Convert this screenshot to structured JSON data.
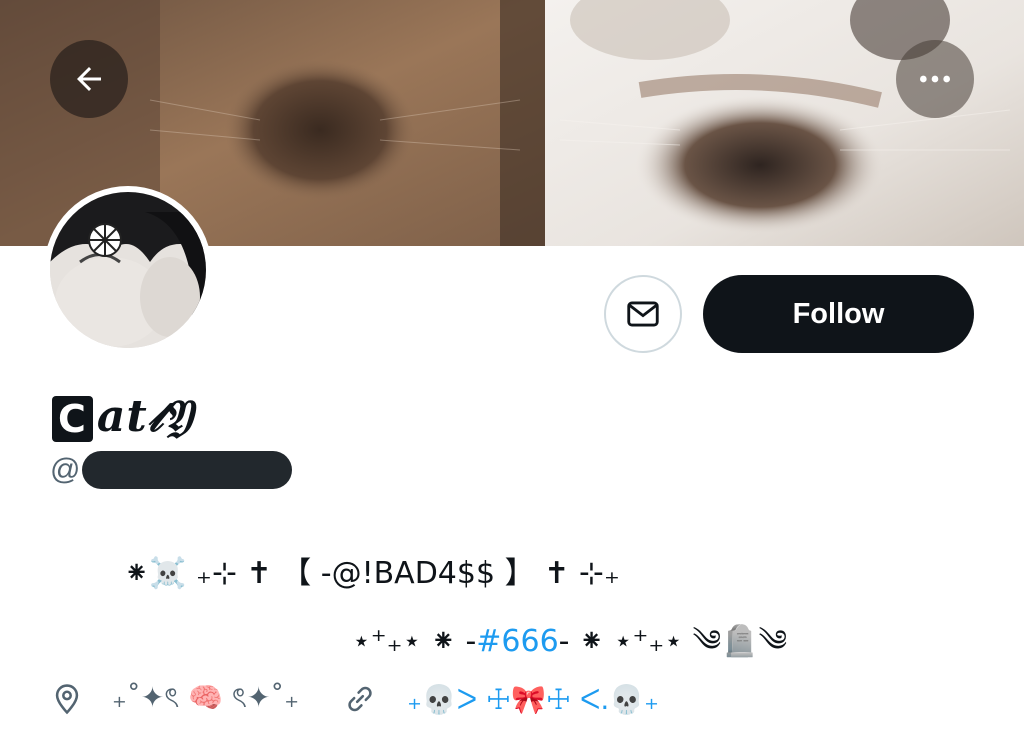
{
  "header": {
    "back_icon": "arrow-left-icon",
    "more_icon": "more-horizontal-icon"
  },
  "actions": {
    "message_icon": "mail-icon",
    "follow_label": "Follow"
  },
  "profile": {
    "name_boxed": "C",
    "name_rest": "at𝓉𝔜",
    "handle_prefix": "@"
  },
  "bio": {
    "line1": "⁕☠️ ₊⊹ ✝ 【 -@!BAD4$$ 】 ✝ ⊹₊",
    "line2_prefix": "⋆⁺₊⋆ ⁕ -",
    "hashtag": "#666",
    "line2_suffix": "- ⁕ ⋆⁺₊⋆ ༄🪦༄"
  },
  "meta": {
    "location_icon": "location-pin-icon",
    "location": "₊˚✦ৎ 🧠 ৎ✦˚₊",
    "link_icon": "link-icon",
    "link": "₊💀ᐳ ☩🎀☩ ᐸ.💀₊"
  },
  "colors": {
    "accent": "#1d9bf0",
    "follow_bg": "#0f1419",
    "secondary_text": "#536471",
    "border": "#cfd9de"
  }
}
